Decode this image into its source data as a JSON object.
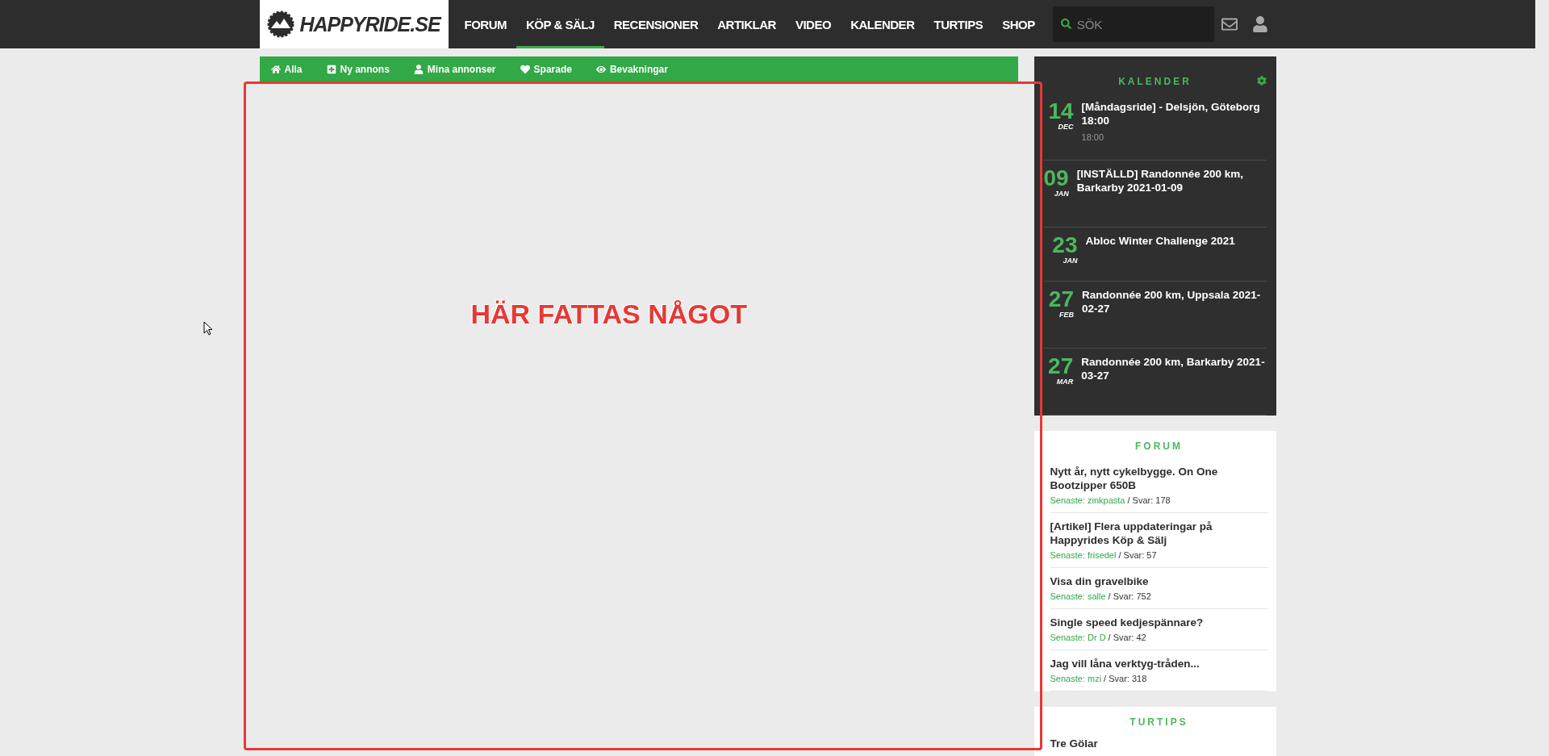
{
  "header": {
    "logo": "HAPPYRIDE.SE",
    "nav": [
      {
        "label": "FORUM",
        "selected": false
      },
      {
        "label": "KÖP & SÄLJ",
        "selected": true
      },
      {
        "label": "RECENSIONER",
        "selected": false
      },
      {
        "label": "ARTIKLAR",
        "selected": false
      },
      {
        "label": "VIDEO",
        "selected": false
      },
      {
        "label": "KALENDER",
        "selected": false
      },
      {
        "label": "TURTIPS",
        "selected": false
      },
      {
        "label": "SHOP",
        "selected": false
      }
    ],
    "search": {
      "placeholder": "SÖK"
    }
  },
  "subnav": [
    {
      "label": "Alla"
    },
    {
      "label": "Ny annons"
    },
    {
      "label": "Mina annonser"
    },
    {
      "label": "Sparade"
    },
    {
      "label": "Bevakningar"
    }
  ],
  "annotation": {
    "text": "HÄR FATTAS NÅGOT"
  },
  "calendar": {
    "title": "KALENDER",
    "events": [
      {
        "day": "14",
        "month": "DEC",
        "title": "[Måndagsride] - Delsjön, Göteborg 18:00",
        "time": "18:00"
      },
      {
        "day": "09",
        "month": "JAN",
        "title": "[INSTÄLLD] Randonnée 200 km, Barkarby 2021-01-09"
      },
      {
        "day": "23",
        "month": "JAN",
        "title": "Abloc Winter Challenge 2021"
      },
      {
        "day": "27",
        "month": "FEB",
        "title": "Randonnée 200 km, Uppsala 2021-02-27"
      },
      {
        "day": "27",
        "month": "MAR",
        "title": "Randonnée 200 km, Barkarby 2021-03-27"
      }
    ]
  },
  "forum": {
    "title": "FORUM",
    "threads": [
      {
        "title": "Nytt år, nytt cykelbygge. On One Bootzipper 650B",
        "latest": "Senaste: zinkpasta",
        "replies": "/ Svar: 178"
      },
      {
        "title": "[Artikel] Flera uppdateringar på Happyrides Köp & Sälj",
        "latest": "Senaste: frisedel",
        "replies": "/ Svar: 57"
      },
      {
        "title": "Visa din gravelbike",
        "latest": "Senaste: salle",
        "replies": "/ Svar: 752"
      },
      {
        "title": "Single speed kedjespännare?",
        "latest": "Senaste: Dr D",
        "replies": "/ Svar: 42"
      },
      {
        "title": "Jag vill låna verktyg-tråden...",
        "latest": "Senaste: mzi",
        "replies": "/ Svar: 318"
      }
    ]
  },
  "turtips": {
    "title": "TURTIPS",
    "items": [
      {
        "title": "Tre Gölar"
      }
    ]
  }
}
